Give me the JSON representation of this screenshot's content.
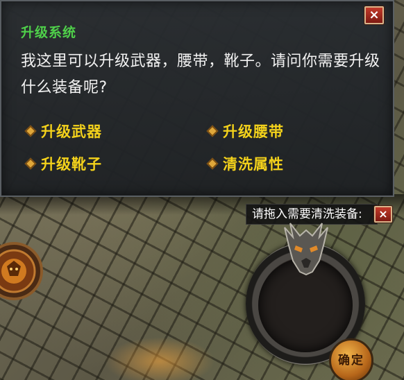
{
  "dialog": {
    "title": "升级系统",
    "message": "我这里可以升级武器，腰带，靴子。请问你需要升级什么装备呢?",
    "options": [
      {
        "label": "升级武器"
      },
      {
        "label": "升级腰带"
      },
      {
        "label": "升级靴子"
      },
      {
        "label": "清洗属性"
      }
    ],
    "close_label": "×"
  },
  "slot_panel": {
    "label": "请拖入需要清洗装备:",
    "close_label": "×",
    "confirm_label": "确定"
  },
  "colors": {
    "title_green": "#4fd04a",
    "option_yellow": "#f4d21b",
    "close_red": "#c23a2a"
  }
}
